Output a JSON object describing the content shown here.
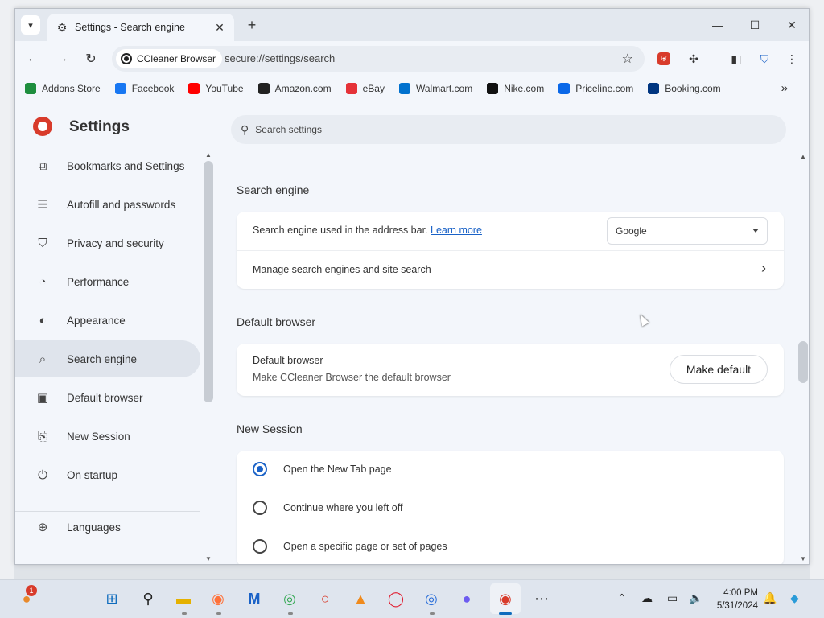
{
  "tab": {
    "title": "Settings - Search engine",
    "icon": "gear-icon"
  },
  "toolbar": {
    "site_chip": "CCleaner Browser",
    "url": "secure://settings/search"
  },
  "bookmarks": [
    {
      "label": "Addons Store",
      "icon": "addons-store-icon",
      "color": "#1e8e3e"
    },
    {
      "label": "Facebook",
      "icon": "facebook-icon",
      "color": "#1877f2"
    },
    {
      "label": "YouTube",
      "icon": "youtube-icon",
      "color": "#ff0000"
    },
    {
      "label": "Amazon.com",
      "icon": "amazon-icon",
      "color": "#222222"
    },
    {
      "label": "eBay",
      "icon": "ebay-icon",
      "color": "#e53238"
    },
    {
      "label": "Walmart.com",
      "icon": "walmart-icon",
      "color": "#0071ce"
    },
    {
      "label": "Nike.com",
      "icon": "nike-icon",
      "color": "#111111"
    },
    {
      "label": "Priceline.com",
      "icon": "priceline-icon",
      "color": "#0a68e8"
    },
    {
      "label": "Booking.com",
      "icon": "booking-icon",
      "color": "#003580"
    }
  ],
  "header": {
    "title": "Settings",
    "search_placeholder": "Search settings"
  },
  "sidebar": {
    "items": [
      {
        "label": "Bookmarks and Settings",
        "icon": "bookmarks-import-icon",
        "glyph": "⧉"
      },
      {
        "label": "Autofill and passwords",
        "icon": "autofill-icon",
        "glyph": "☰"
      },
      {
        "label": "Privacy and security",
        "icon": "shield-icon",
        "glyph": "⛉"
      },
      {
        "label": "Performance",
        "icon": "speedometer-icon",
        "glyph": "◔"
      },
      {
        "label": "Appearance",
        "icon": "palette-icon",
        "glyph": "◐"
      },
      {
        "label": "Search engine",
        "icon": "search-icon",
        "glyph": "⌕"
      },
      {
        "label": "Default browser",
        "icon": "browser-window-icon",
        "glyph": "▣"
      },
      {
        "label": "New Session",
        "icon": "new-session-icon",
        "glyph": "⎘"
      },
      {
        "label": "On startup",
        "icon": "power-icon",
        "glyph": "⏻"
      },
      {
        "label": "Languages",
        "icon": "globe-icon",
        "glyph": "⊕"
      }
    ],
    "active": "Search engine"
  },
  "search_engine": {
    "section_title": "Search engine",
    "address_bar_label": "Search engine used in the address bar.",
    "learn_more": "Learn more",
    "selected_engine": "Google",
    "manage_label": "Manage search engines and site search"
  },
  "default_browser": {
    "section_title": "Default browser",
    "title": "Default browser",
    "subtitle": "Make CCleaner Browser the default browser",
    "button": "Make default"
  },
  "new_session": {
    "section_title": "New Session",
    "options": [
      {
        "label": "Open the New Tab page",
        "checked": true
      },
      {
        "label": "Continue where you left off",
        "checked": false
      },
      {
        "label": "Open a specific page or set of pages",
        "checked": false
      }
    ]
  },
  "taskbar": {
    "time": "4:00 PM",
    "date": "5/31/2024",
    "notification_count": "1",
    "apps": [
      "windows-start-icon",
      "search-icon",
      "file-explorer-icon",
      "firefox-icon",
      "malwarebytes-icon",
      "chrome-icon",
      "opera-icon",
      "vlc-icon",
      "opera-gx-icon",
      "chrome-beta-icon",
      "browser-icon",
      "ccleaner-browser-icon",
      "more-icon"
    ]
  }
}
